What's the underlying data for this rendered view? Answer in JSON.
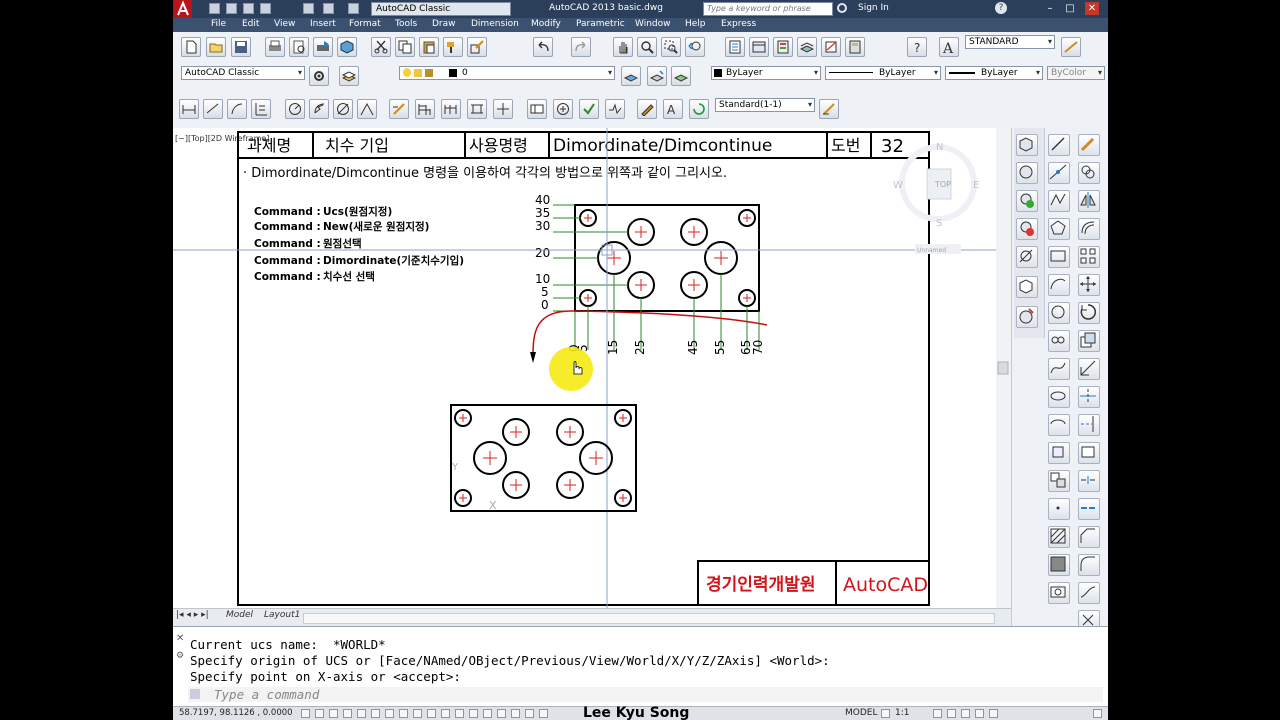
{
  "app": {
    "workspace": "AutoCAD Classic",
    "title": "AutoCAD 2013    basic.dwg",
    "search_placeholder": "Type a keyword or phrase",
    "sign_in": "Sign In"
  },
  "menu": [
    "File",
    "Edit",
    "View",
    "Insert",
    "Format",
    "Tools",
    "Draw",
    "Dimension",
    "Modify",
    "Parametric",
    "Window",
    "Help",
    "Express"
  ],
  "toolbars": {
    "text_style": "STANDARD",
    "workspace": "AutoCAD Classic",
    "layer": "0",
    "color": "ByLayer",
    "linetype": "ByLayer",
    "lineweight": "ByLayer",
    "plotstyle": "ByColor",
    "dim_style": "Standard(1-1)"
  },
  "viewport": {
    "label": "[−][Top][2D Wireframe]",
    "viewcube": {
      "north": "N",
      "south": "S",
      "east": "E",
      "west": "W",
      "top": "TOP",
      "ucs": "Unnamed"
    }
  },
  "sheet": {
    "header": {
      "topic_label": "과제명",
      "topic_value": "치수 기입",
      "command_label": "사용명령",
      "command_value": "Dimordinate/Dimcontinue",
      "number_label": "도번",
      "number_value": "32"
    },
    "instruction": "· Dimordinate/Dimcontinue 명령을 이용하여 각각의 방법으로 위쪽과 같이 그리시오.",
    "steps": [
      {
        "cmd": "Command :",
        "text": "Ucs(원점지정)"
      },
      {
        "cmd": "Command :",
        "text": "New(새로운 원점지정)"
      },
      {
        "cmd": "Command :",
        "text": "원점선택"
      },
      {
        "cmd": "Command :",
        "text": "Dimordinate(기준치수기입)"
      },
      {
        "cmd": "Command :",
        "text": "치수선 선택"
      }
    ],
    "y_dims": [
      "40",
      "35",
      "30",
      "20",
      "10",
      "5",
      "0"
    ],
    "x_dims": [
      "0",
      "5",
      "15",
      "25",
      "45",
      "55",
      "65",
      "70"
    ],
    "footer_org": "경기인력개발원",
    "footer_app": "AutoCAD"
  },
  "layout_tabs": [
    "Model",
    "Layout1"
  ],
  "command_history": [
    "Current ucs name:  *WORLD*",
    "Specify origin of UCS or [Face/NAmed/OBject/Previous/View/World/X/Y/Z/ZAxis] <World>:",
    "Specify point on X-axis or <accept>:"
  ],
  "command_placeholder": "Type a command",
  "status": {
    "coords": "58.7197, 98.1126 , 0.0000",
    "author": "Lee Kyu Song",
    "model": "MODEL",
    "scale": "1:1"
  }
}
